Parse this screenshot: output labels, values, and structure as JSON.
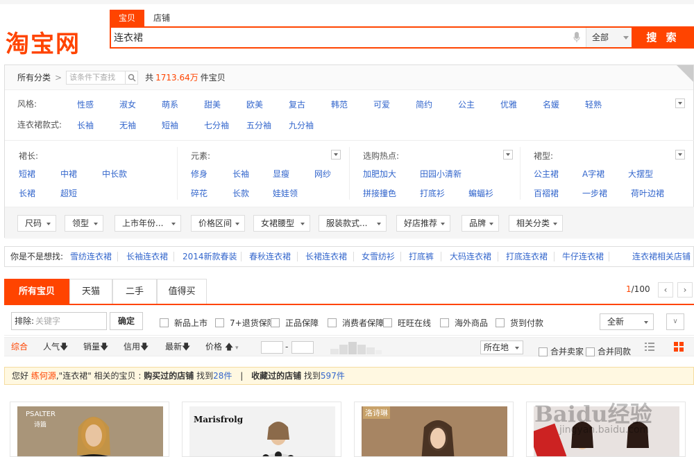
{
  "header": {
    "logo_text": "淘宝网",
    "search_tabs": [
      "宝贝",
      "店铺"
    ],
    "search_value": "连衣裙",
    "scope_select": "全部",
    "search_button": "搜 索"
  },
  "filter": {
    "all_categories": "所有分类",
    "filter_placeholder": "该条件下查找",
    "count_prefix": "共",
    "count_value": "1713.64万",
    "count_suffix": "件宝贝",
    "style_label": "风格:",
    "style_options": [
      "性感",
      "淑女",
      "萌系",
      "甜美",
      "欧美",
      "复古",
      "韩范",
      "可爱",
      "简约",
      "公主",
      "优雅",
      "名媛",
      "轻熟"
    ],
    "sleeve_label": "连衣裙款式:",
    "sleeve_options": [
      "长袖",
      "无袖",
      "短袖",
      "七分袖",
      "五分袖",
      "九分袖"
    ],
    "length_label": "裙长:",
    "length_options": [
      "短裙",
      "中裙",
      "中长款",
      "长裙",
      "超短"
    ],
    "element_label": "元素:",
    "element_options": [
      "修身",
      "长袖",
      "显瘦",
      "网纱",
      "碎花",
      "长款",
      "娃娃领"
    ],
    "hot_label": "选购热点:",
    "hot_options": [
      "加肥加大",
      "田园小清新",
      "拼接撞色",
      "打底衫",
      "蝙蝠衫"
    ],
    "shape_label": "裙型:",
    "shape_options": [
      "公主裙",
      "A字裙",
      "大摆型",
      "百褶裙",
      "一步裙",
      "荷叶边裙"
    ],
    "dropdowns": [
      "尺码",
      "领型",
      "上市年份...",
      "价格区间",
      "女裙腰型",
      "服装款式...",
      "好店推荐",
      "品牌",
      "相关分类"
    ]
  },
  "suggest": {
    "label": "你是不是想找:",
    "items": [
      "雪纺连衣裙",
      "长袖连衣裙",
      "2014新款春装",
      "春秋连衣裙",
      "长裙连衣裙",
      "女雪纺衫",
      "打底裤",
      "大码连衣裙",
      "打底连衣裙",
      "牛仔连衣裙"
    ],
    "shop_link": "连衣裙相关店铺"
  },
  "result_tabs": [
    "所有宝贝",
    "天猫",
    "二手",
    "值得买"
  ],
  "pager": {
    "current": "1",
    "total": "/100"
  },
  "toolbar": {
    "exclude_label": "排除:",
    "exclude_placeholder": "关键字",
    "ok_button": "确定",
    "checks": [
      "新品上市",
      "7+退货保障",
      "正品保障",
      "消费者保障",
      "旺旺在线",
      "海外商品",
      "货到付款"
    ],
    "sort_select": "全新"
  },
  "sortbar": {
    "items": [
      "综合",
      "人气",
      "销量",
      "信用",
      "最新",
      "价格"
    ],
    "price_dash": "-",
    "location": "所在地",
    "merge_seller": "合并卖家",
    "merge_same": "合并同款"
  },
  "notice": {
    "hello": "您好",
    "user": "练何源",
    "mid": ",\"连衣裙\" 相关的宝贝 :",
    "bought": "购买过的店铺",
    "found1": "找到",
    "bought_count": "28件",
    "divider": "|",
    "fav": "收藏过的店铺",
    "found2": "找到",
    "fav_count": "597件"
  },
  "cards": [
    {
      "brand": "PSALTER",
      "brand_sub": "诗篇"
    },
    {
      "brand": "Marisfrolg"
    },
    {
      "brand": "洛诗琳"
    },
    {
      "brand": ""
    }
  ],
  "watermark": {
    "main": "Baidu经验",
    "sub": "jingyan.baidu.com"
  },
  "colors": {
    "accent": "#ff4400",
    "link": "#3366cc"
  }
}
